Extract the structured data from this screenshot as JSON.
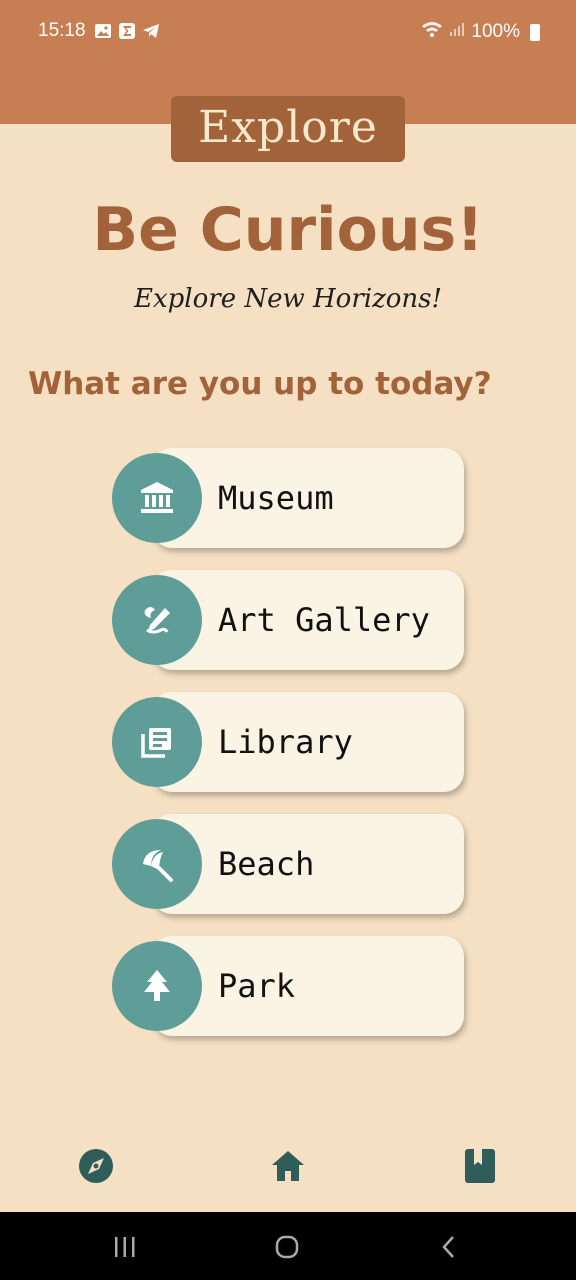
{
  "status_bar": {
    "time": "15:18",
    "battery": "100%"
  },
  "header": {
    "title": "Explore"
  },
  "hero": {
    "headline": "Be Curious!",
    "subheadline": "Explore New Horizons!"
  },
  "prompt": {
    "question": "What are you up to today?"
  },
  "options": [
    {
      "label": "Museum",
      "icon": "museum-icon"
    },
    {
      "label": "Art Gallery",
      "icon": "brush-pencil-icon"
    },
    {
      "label": "Library",
      "icon": "library-books-icon"
    },
    {
      "label": "Beach",
      "icon": "beach-umbrella-icon"
    },
    {
      "label": "Park",
      "icon": "tree-icon"
    }
  ],
  "bottom_nav": {
    "items": [
      {
        "icon": "compass-icon"
      },
      {
        "icon": "home-icon"
      },
      {
        "icon": "bookmark-book-icon"
      }
    ]
  },
  "colors": {
    "background": "#F5E0C4",
    "header_band": "#C77E52",
    "accent_brown": "#A2633B",
    "teal": "#5F9D98",
    "card": "#FBF3E4",
    "nav_icon": "#2F5D5A"
  }
}
